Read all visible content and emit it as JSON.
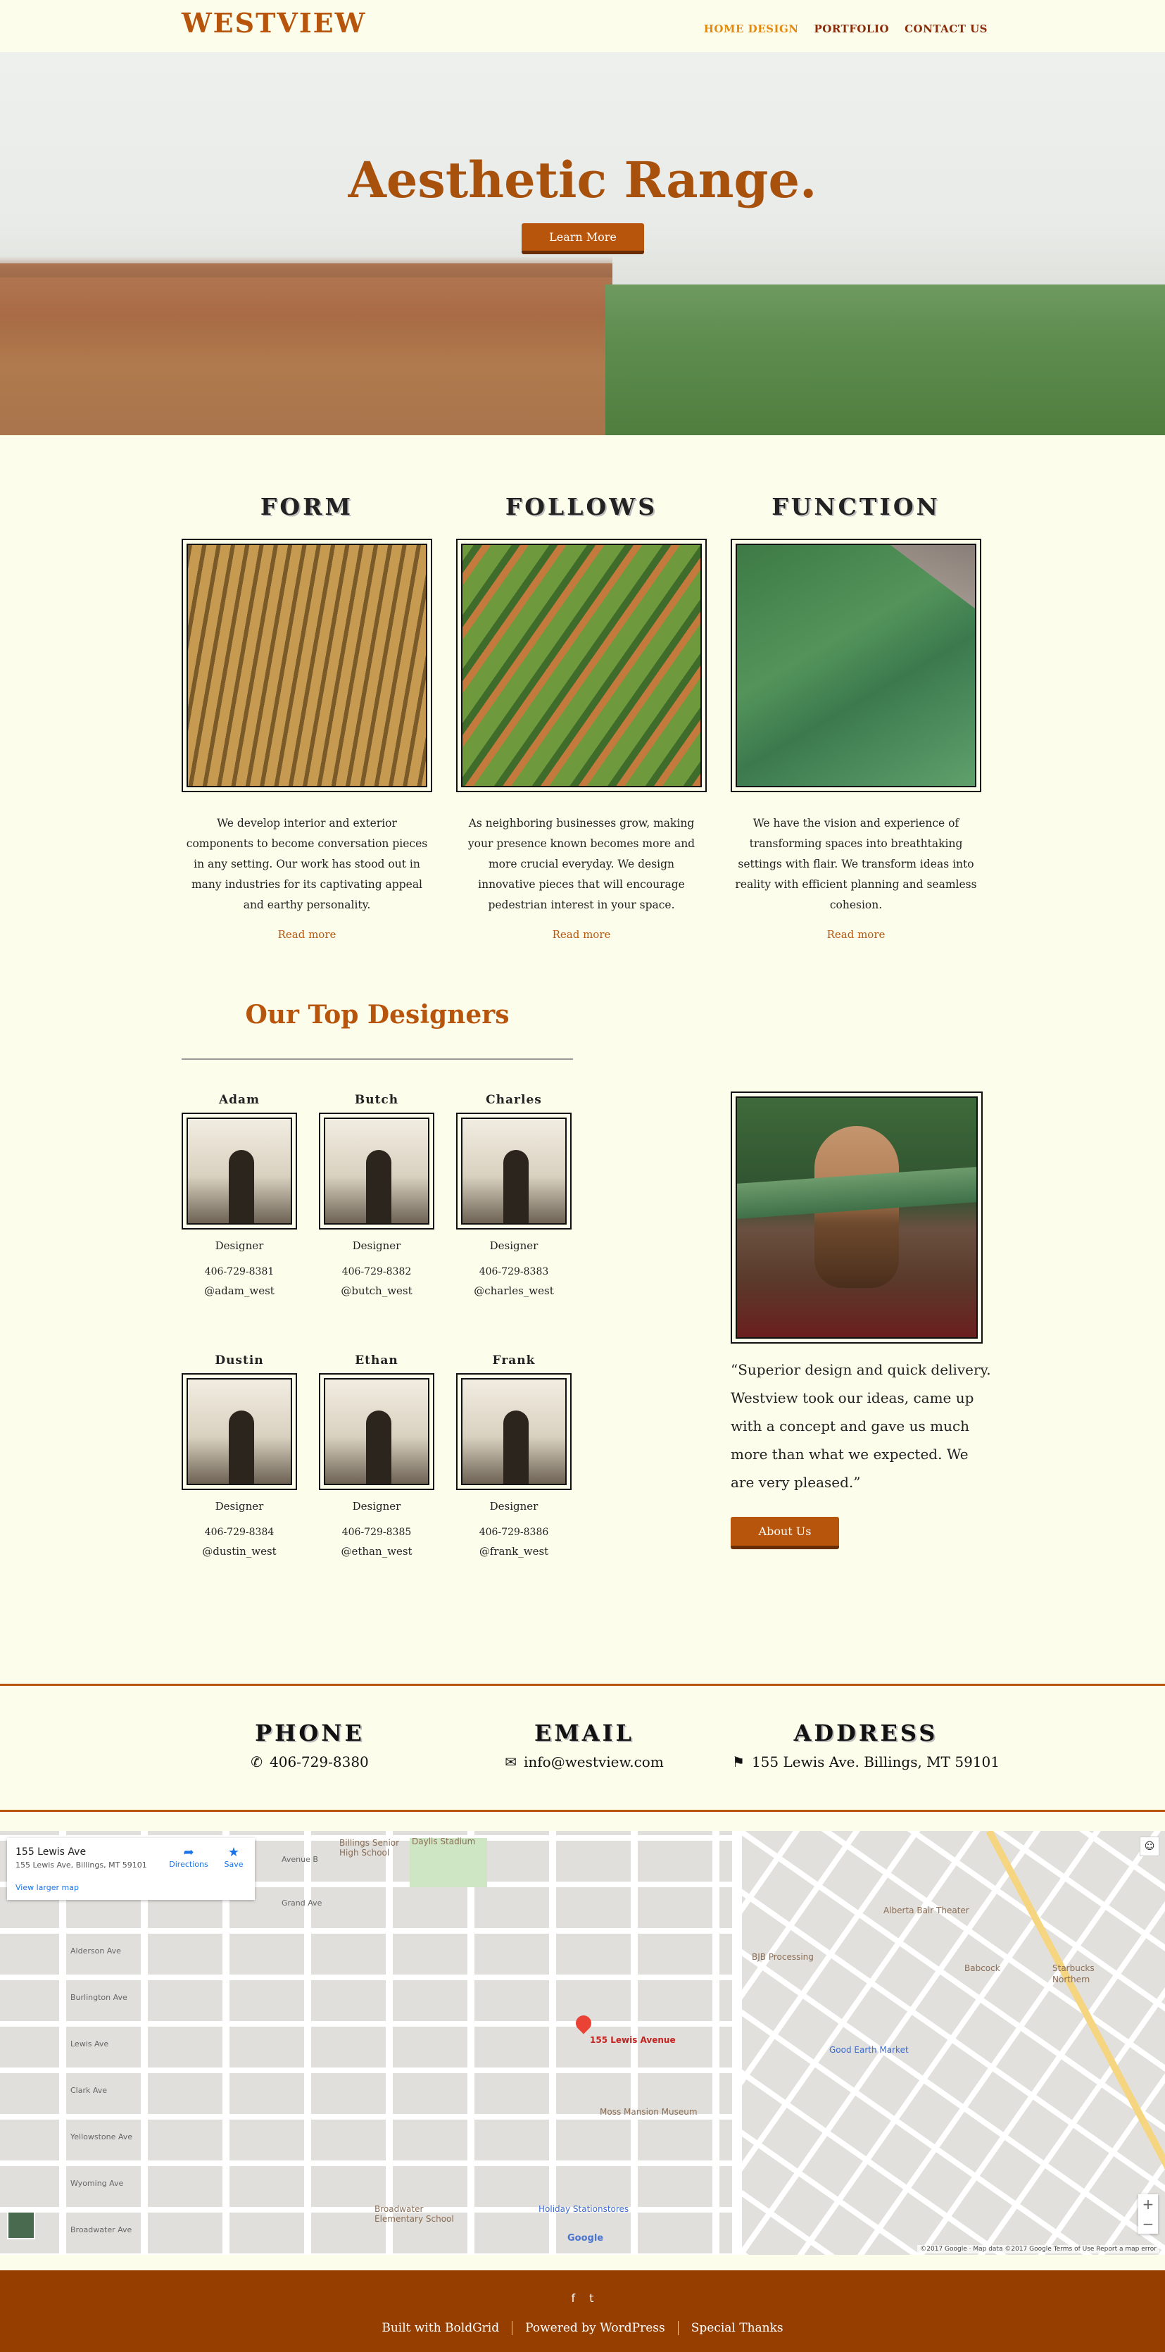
{
  "header": {
    "logo": "WESTVIEW",
    "nav": [
      "HOME DESIGN",
      "PORTFOLIO",
      "CONTACT US"
    ]
  },
  "hero": {
    "title": "Aesthetic Range.",
    "button": "Learn More"
  },
  "features": [
    {
      "title": "FORM",
      "text": "We develop interior and exterior components to become conversation pieces in any setting. Our work has stood out in many industries for its captivating appeal and earthy personality.",
      "link": "Read more"
    },
    {
      "title": "FOLLOWS",
      "text": "As neighboring businesses grow, making your presence known becomes more and more crucial everyday. We design innovative pieces that will encourage pedestrian interest in your space.",
      "link": "Read more"
    },
    {
      "title": "FUNCTION",
      "text": "We have the vision and experience of transforming spaces into breathtaking settings with flair. We transform ideas into reality with efficient planning and seamless cohesion.",
      "link": "Read more"
    }
  ],
  "designers": {
    "title": "Our Top Designers",
    "people": [
      {
        "name": "Adam",
        "role": "Designer",
        "phone": "406-729-8381",
        "handle": "@adam_west"
      },
      {
        "name": "Butch",
        "role": "Designer",
        "phone": "406-729-8382",
        "handle": "@butch_west"
      },
      {
        "name": "Charles",
        "role": "Designer",
        "phone": "406-729-8383",
        "handle": "@charles_west"
      },
      {
        "name": "Dustin",
        "role": "Designer",
        "phone": "406-729-8384",
        "handle": "@dustin_west"
      },
      {
        "name": "Ethan",
        "role": "Designer",
        "phone": "406-729-8385",
        "handle": "@ethan_west"
      },
      {
        "name": "Frank",
        "role": "Designer",
        "phone": "406-729-8386",
        "handle": "@frank_west"
      }
    ]
  },
  "testimonial": {
    "quote": "“Superior design and quick delivery. Westview took our ideas, came up with a concept and gave us much more than what we expected. We are very pleased.”",
    "button": "About Us"
  },
  "contact": {
    "phone": {
      "label": "PHONE",
      "value": "406-729-8380"
    },
    "email": {
      "label": "EMAIL",
      "value": "info@westview.com"
    },
    "address": {
      "label": "ADDRESS",
      "value": "155 Lewis Ave. Billings, MT 59101"
    }
  },
  "map": {
    "card_title": "155 Lewis Ave",
    "card_address": "155 Lewis Ave, Billings, MT 59101",
    "card_link": "View larger map",
    "directions": "Directions",
    "save": "Save",
    "pin_label": "155 Lewis Avenue",
    "streets": [
      "Avenue B",
      "Grand Ave",
      "Alderson Ave",
      "Burlington Ave",
      "Lewis Ave",
      "Clark Ave",
      "Yellowstone Ave",
      "Wyoming Ave",
      "Broadwater Ave"
    ],
    "pois": [
      "Billings Senior High School",
      "Daylis Stadium",
      "Alberta Bair Theater",
      "BJB Processing",
      "Babcock",
      "Starbucks",
      "Northern",
      "Good Earth Market",
      "Moss Mansion Museum",
      "Broadwater Elementary School",
      "Holiday Stationstores"
    ],
    "google": "Google",
    "attribution": "©2017 Google · Map data ©2017 Google   Terms of Use   Report a map error",
    "zoom_in": "+",
    "zoom_out": "−"
  },
  "footer": {
    "social": [
      "f",
      "t"
    ],
    "links": [
      "Built with BoldGrid",
      "Powered by WordPress",
      "Special Thanks"
    ]
  },
  "colors": {
    "accent": "#b8550c",
    "background": "#fdfdeb",
    "footer": "#953e00",
    "nav_active": "#e38b10"
  }
}
